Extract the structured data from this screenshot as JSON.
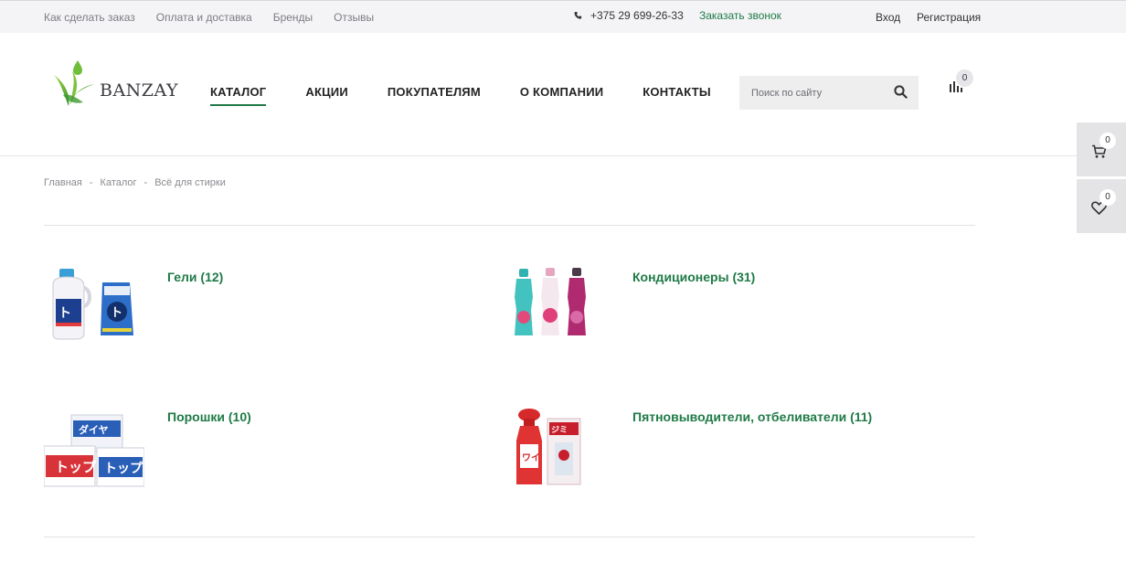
{
  "topbar": {
    "links": [
      "Как сделать заказ",
      "Оплата и доставка",
      "Бренды",
      "Отзывы"
    ],
    "phone": "+375 29 699-26-33",
    "callback": "Заказать звонок",
    "login": "Вход",
    "register": "Регистрация"
  },
  "header": {
    "logo_text": "BANZAY",
    "nav": [
      "КАТАЛОГ",
      "АКЦИИ",
      "ПОКУПАТЕЛЯМ",
      "О КОМПАНИИ",
      "КОНТАКТЫ"
    ],
    "active_nav": "КАТАЛОГ",
    "search_placeholder": "Поиск по сайту",
    "compare_count": "0"
  },
  "side_panel": {
    "cart_count": "0",
    "wishlist_count": "0"
  },
  "breadcrumb": [
    "Главная",
    "Каталог",
    "Всё для стирки"
  ],
  "sections": [
    {
      "title": "Гели (12)",
      "icon": "gel-bottles-image"
    },
    {
      "title": "Кондиционеры (31)",
      "icon": "conditioner-bottles-image"
    },
    {
      "title": "Порошки (10)",
      "icon": "powder-boxes-image"
    },
    {
      "title": "Пятновыводители, отбеливатели (11)",
      "icon": "stain-remover-image"
    }
  ],
  "colors": {
    "accent": "#1f7a47",
    "topbar_bg": "#f4f4f6",
    "side_bg": "#e4e4e6"
  }
}
